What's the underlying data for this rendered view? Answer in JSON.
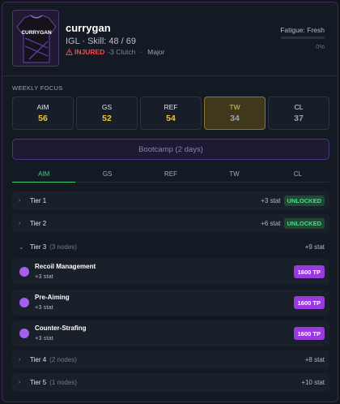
{
  "player": {
    "name": "currygan",
    "role_line": "IGL · Skill: 48 / 69",
    "status": "INJURED",
    "status_detail": "-3 Clutch",
    "tier": "Major",
    "jersey_text": "CURRYGAN",
    "fatigue_label": "Fatigue: Fresh",
    "fatigue_value": "0%",
    "fatigue_fraction": 0
  },
  "weekly_focus": {
    "label": "WEEKLY FOCUS",
    "items": [
      {
        "name": "AIM",
        "value": "56"
      },
      {
        "name": "GS",
        "value": "52"
      },
      {
        "name": "REF",
        "value": "54"
      },
      {
        "name": "TW",
        "value": "34"
      },
      {
        "name": "CL",
        "value": "37"
      }
    ]
  },
  "bootcamp_label": "Bootcamp (2 days)",
  "tabs": [
    "AIM",
    "GS",
    "REF",
    "TW",
    "CL"
  ],
  "tiers": [
    {
      "name": "Tier 1",
      "nodes": "",
      "stat": "+3 stat",
      "badge": "UNLOCKED"
    },
    {
      "name": "Tier 2",
      "nodes": "",
      "stat": "+6 stat",
      "badge": "UNLOCKED"
    },
    {
      "name": "Tier 3",
      "nodes": "(3 nodes)",
      "stat": "+9 stat",
      "badge": ""
    },
    {
      "name": "Tier 4",
      "nodes": "(2 nodes)",
      "stat": "+8 stat",
      "badge": ""
    },
    {
      "name": "Tier 5",
      "nodes": "(1 nodes)",
      "stat": "+10 stat",
      "badge": ""
    }
  ],
  "tier3_nodes": [
    {
      "name": "Recoil Management",
      "stat": "+3 stat",
      "cost": "1600 TP"
    },
    {
      "name": "Pre-Aiming",
      "stat": "+3 stat",
      "cost": "1600 TP"
    },
    {
      "name": "Counter-Strafing",
      "stat": "+3 stat",
      "cost": "1600 TP"
    }
  ],
  "colors": {
    "accent_purple": "#9b39e0",
    "accent_green": "#3fd07a",
    "accent_yellow": "#f3c530",
    "injured_red": "#ef4c4c"
  }
}
